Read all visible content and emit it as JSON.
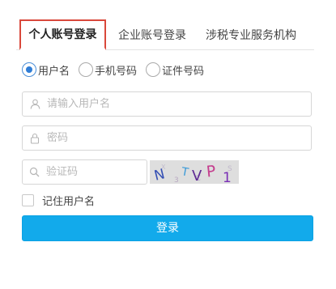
{
  "tabs": [
    {
      "label": "个人账号登录",
      "active": true
    },
    {
      "label": "企业账号登录",
      "active": false
    },
    {
      "label": "涉税专业服务机构",
      "active": false
    }
  ],
  "login_types": [
    {
      "label": "用户名",
      "checked": true
    },
    {
      "label": "手机号码",
      "checked": false
    },
    {
      "label": "证件号码",
      "checked": false
    }
  ],
  "form": {
    "username_placeholder": "请输入用户名",
    "password_placeholder": "密码",
    "captcha_placeholder": "验证码"
  },
  "captcha": {
    "chars": [
      "N",
      "T",
      "V",
      "P",
      "1"
    ],
    "noise_chars": [
      "3",
      "C",
      "S",
      "X"
    ]
  },
  "remember_label": "记住用户名",
  "login_button_label": "登录",
  "colors": {
    "accent": "#12aaeb",
    "tab_highlight": "#d9483b",
    "radio_selected": "#2f7dd6"
  }
}
